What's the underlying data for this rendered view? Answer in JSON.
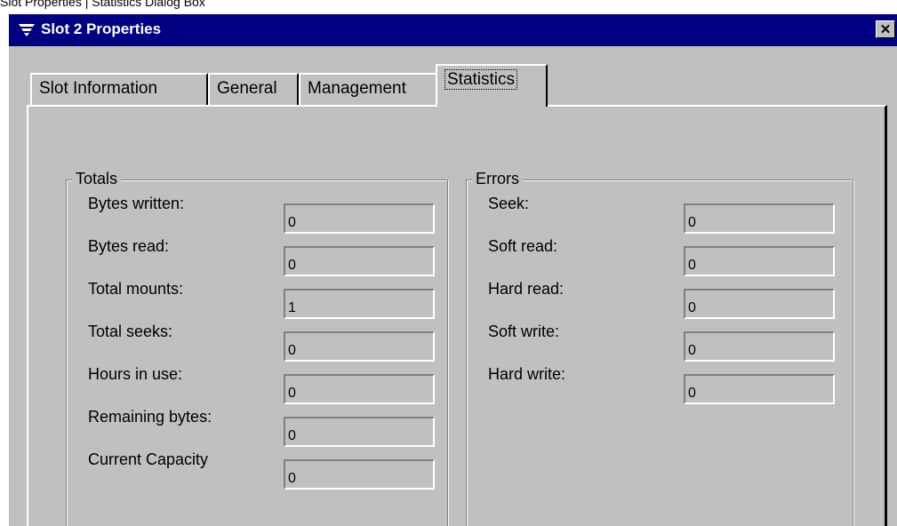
{
  "caption": "Slot Properties | Statistics Dialog Box",
  "window": {
    "title": "Slot 2 Properties",
    "close_label": "✕"
  },
  "tabs": [
    {
      "label": "Slot Information"
    },
    {
      "label": "General"
    },
    {
      "label": "Management"
    },
    {
      "label": "Statistics",
      "active": true
    }
  ],
  "totals": {
    "title": "Totals",
    "rows": [
      {
        "label": "Bytes written:",
        "value": "0"
      },
      {
        "label": "Bytes read:",
        "value": "0"
      },
      {
        "label": "Total mounts:",
        "value": "1"
      },
      {
        "label": "Total seeks:",
        "value": "0"
      },
      {
        "label": "Hours in use:",
        "value": "0"
      },
      {
        "label": "Remaining bytes:",
        "value": "0"
      },
      {
        "label": "Current Capacity",
        "value": "0"
      }
    ]
  },
  "errors": {
    "title": "Errors",
    "rows": [
      {
        "label": "Seek:",
        "value": "0"
      },
      {
        "label": "Soft read:",
        "value": "0"
      },
      {
        "label": "Hard read:",
        "value": "0"
      },
      {
        "label": "Soft write:",
        "value": "0"
      },
      {
        "label": "Hard write:",
        "value": "0"
      }
    ]
  },
  "colors": {
    "titlebar": "#000080",
    "face": "#c0c0c0"
  }
}
